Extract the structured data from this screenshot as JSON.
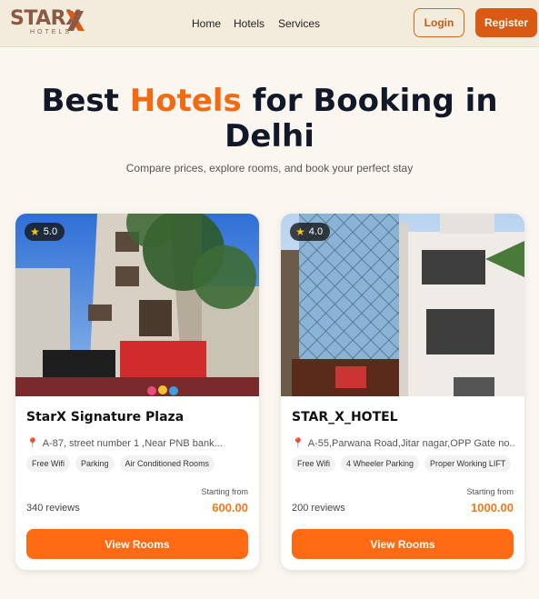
{
  "brand": {
    "name": "STARX",
    "tagline": "HOTELS",
    "accent": "#d95a12"
  },
  "nav": {
    "home": "Home",
    "hotels": "Hotels",
    "services": "Services"
  },
  "auth": {
    "login": "Login",
    "register": "Register"
  },
  "hero": {
    "title_part1": "Best ",
    "title_accent": "Hotels",
    "title_part2": " for Booking in Delhi",
    "subtitle": "Compare prices, explore rooms, and book your perfect stay"
  },
  "hotels": [
    {
      "rating": "5.0",
      "name": "StarX Signature Plaza",
      "address": "A-87, street number 1 ,Near PNB bank...",
      "tags": [
        "Free Wifi",
        "Parking",
        "Air Conditioned Rooms"
      ],
      "reviews": "340 reviews",
      "starting_from": "Starting from",
      "price": "600.00",
      "cta": "View Rooms"
    },
    {
      "rating": "4.0",
      "name": "STAR_X_HOTEL",
      "address": "A-55,Parwana Road,Jitar nagar,OPP Gate no....",
      "tags": [
        "Free Wifi",
        "4 Wheeler Parking",
        "Proper Working LIFT"
      ],
      "reviews": "200 reviews",
      "starting_from": "Starting from",
      "price": "1000.00",
      "cta": "View Rooms"
    }
  ]
}
